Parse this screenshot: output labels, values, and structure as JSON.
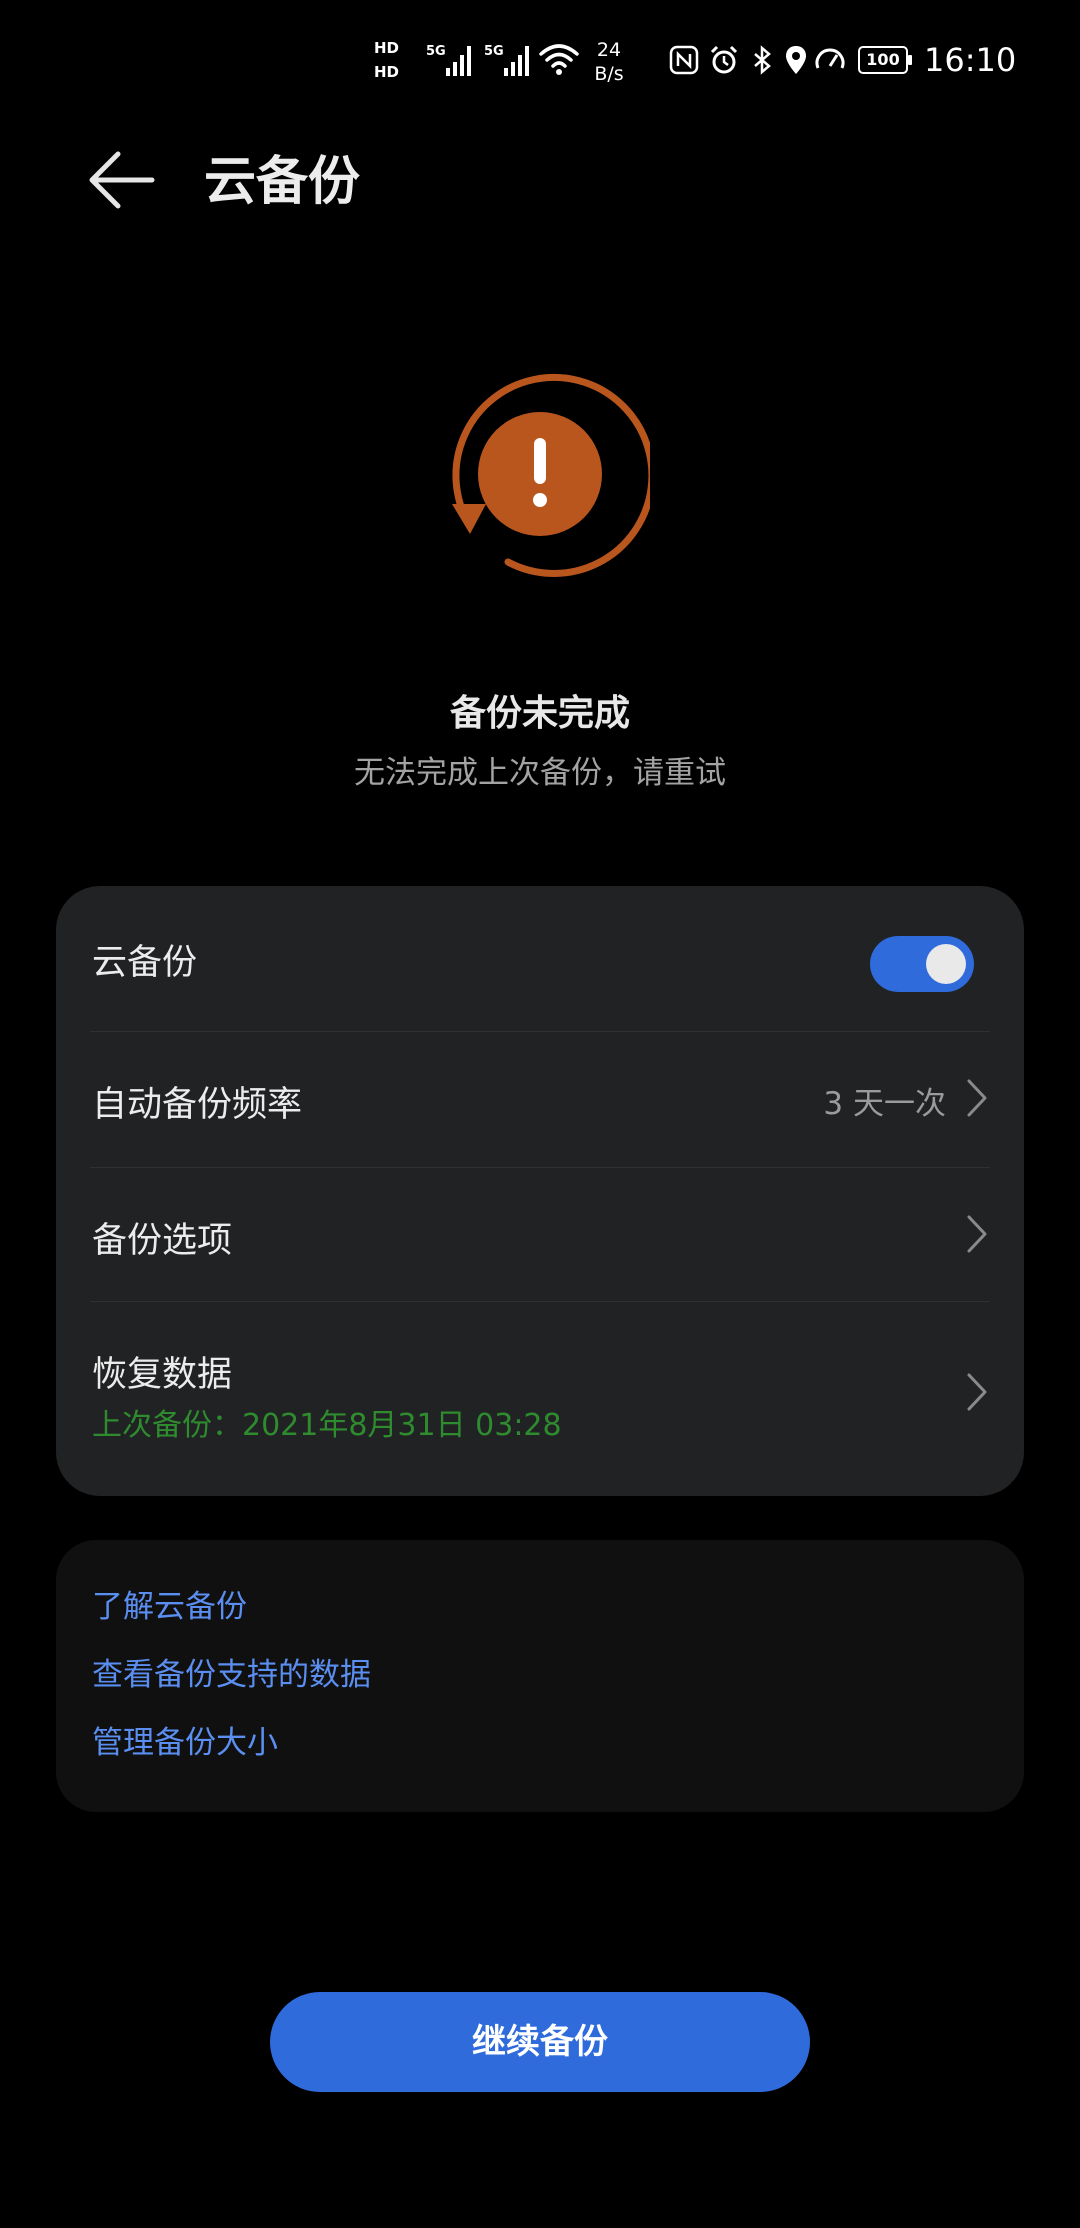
{
  "status_bar": {
    "hd1": "HD",
    "hd2": "HD",
    "net_type1": "5G",
    "net_type2": "5G",
    "net_speed_value": "24",
    "net_speed_unit": "B/s",
    "battery_level": "100",
    "time": "16:10",
    "icons": [
      "nfc-icon",
      "alarm-icon",
      "bluetooth-icon",
      "location-icon",
      "gauge-icon"
    ]
  },
  "header": {
    "title": "云备份",
    "back_icon": "back-arrow-icon"
  },
  "status": {
    "icon": "sync-error-icon",
    "title": "备份未完成",
    "subtitle": "无法完成上次备份，请重试",
    "color": "#b8561e"
  },
  "settings": {
    "cloud_backup": {
      "label": "云备份",
      "toggle_on": true
    },
    "frequency": {
      "label": "自动备份频率",
      "value": "3 天一次"
    },
    "options": {
      "label": "备份选项"
    },
    "restore": {
      "label": "恢复数据",
      "last_backup": "上次备份：2021年8月31日 03:28"
    }
  },
  "links": {
    "learn": "了解云备份",
    "supported": "查看备份支持的数据",
    "manage_size": "管理备份大小"
  },
  "primary_button": {
    "label": "继续备份"
  },
  "colors": {
    "accent": "#2f6bdb",
    "link": "#5a8ef0",
    "success_text": "#2e8b2e",
    "warning": "#b8561e"
  }
}
